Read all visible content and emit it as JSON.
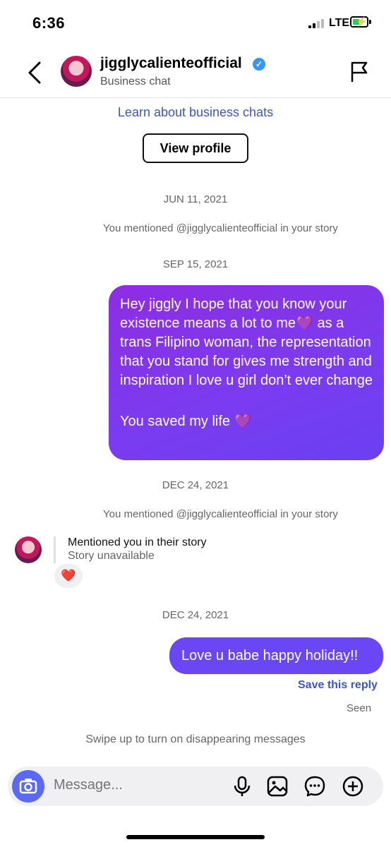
{
  "status_bar": {
    "time": "6:36",
    "network": "LTE"
  },
  "header": {
    "name": "jigglycalienteofficial",
    "subtitle": "Business chat",
    "verified_icon": "verified-badge-icon",
    "back_icon": "chevron-left-icon",
    "report_icon": "flag-icon"
  },
  "info": {
    "learn_link": "Learn about business chats",
    "view_profile": "View profile"
  },
  "messages": {
    "date1": "JUN 11, 2021",
    "mention1": "You mentioned @jigglycalienteofficial in your story",
    "date2": "SEP 15, 2021",
    "msg1_line1": "Hey jiggly I hope that you know your existence means a lot to me💜 as a trans Filipino woman, the representation that you stand for gives me strength and inspiration I love u girl don’t ever change",
    "msg1_line2": "You saved my life 💜",
    "date3": "DEC 24, 2021",
    "mention2": "You mentioned @jigglycalienteofficial in your story",
    "story_title": "Mentioned you in their story",
    "story_sub": "Story unavailable",
    "reaction": "❤️",
    "date4": "DEC 24, 2021",
    "msg2": "Love u babe happy holiday!!",
    "save_reply": "Save this reply",
    "seen": "Seen",
    "swipe_hint": "Swipe up to turn on disappearing messages"
  },
  "composer": {
    "placeholder": "Message...",
    "icons": [
      "camera-icon",
      "microphone-icon",
      "gallery-icon",
      "sticker-chat-icon",
      "plus-icon"
    ]
  },
  "colors": {
    "link": "#3d56c7",
    "bubble_gradient_start": "#8e2de2",
    "bubble_solid": "#6a47f5",
    "camera_button": "#5b6af5"
  }
}
